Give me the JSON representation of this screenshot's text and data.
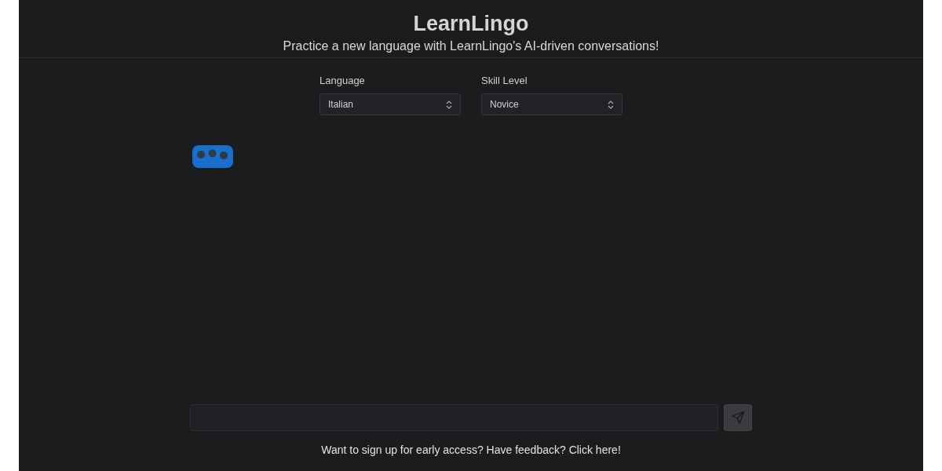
{
  "header": {
    "title": "LearnLingo",
    "subtitle": "Practice a new language with LearnLingo's AI-driven conversations!"
  },
  "settings": [
    {
      "label": "Language",
      "value": "Italian"
    },
    {
      "label": "Skill Level",
      "value": "Novice"
    }
  ],
  "chat": {
    "typing": true
  },
  "footer": {
    "text": "Want to sign up for early access? Have feedback? Click here!"
  }
}
